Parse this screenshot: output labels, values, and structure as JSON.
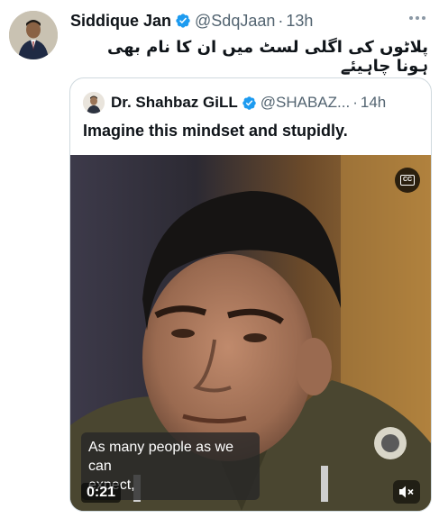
{
  "tweet": {
    "author_name": "Siddique Jan",
    "author_handle": "@SdqJaan",
    "separator": "·",
    "time": "13h",
    "text": "پلاٹوں کی اگلی لسٹ میں ان کا نام بھی ہونا چاہیئے"
  },
  "quoted_tweet": {
    "author_name": "Dr. Shahbaz GiLL",
    "author_handle": "@SHABAZ...",
    "separator": "·",
    "time": "14h",
    "text": "Imagine this mindset and stupidly.",
    "video": {
      "caption_line1": "As many people as we can",
      "caption_line2": "expect,",
      "timestamp": "0:21",
      "cc_label": "CC"
    }
  },
  "icons": {
    "verified": "verified-badge-icon",
    "more": "more-dots-icon",
    "cc": "closed-captions-icon",
    "mute": "muted-speaker-icon"
  },
  "colors": {
    "verified_blue": "#1d9bf0",
    "secondary_text": "#536471",
    "border": "#cfd9de"
  }
}
